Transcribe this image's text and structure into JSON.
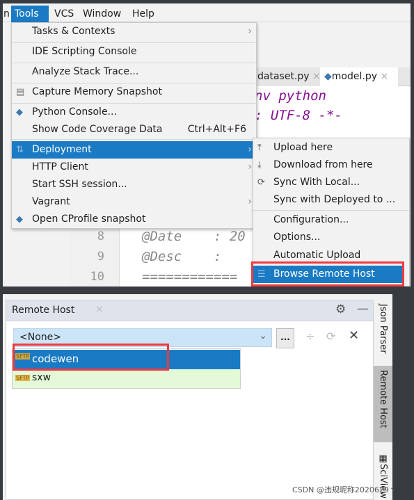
{
  "menubar": {
    "items": [
      {
        "label": "n"
      },
      {
        "label": "Tools"
      },
      {
        "label": "VCS"
      },
      {
        "label": "Window"
      },
      {
        "label": "Help"
      }
    ]
  },
  "editor": {
    "tabs": [
      {
        "label": "dataset.py"
      },
      {
        "label": "model.py"
      }
    ],
    "code": [
      "nv python",
      ": UTF-8 -*-",
      "@Date    : 20",
      "@Desc    :",
      "============"
    ],
    "line_numbers": [
      "8",
      "9",
      "10"
    ]
  },
  "tools_menu": {
    "items": [
      {
        "label": "Tasks & Contexts",
        "submenu": true
      },
      {
        "label": "IDE Scripting Console"
      },
      {
        "label": "Analyze Stack Trace..."
      },
      {
        "label": "Capture Memory Snapshot",
        "icon": "memory-snapshot-icon"
      },
      {
        "label": "Python Console...",
        "icon": "python-icon"
      },
      {
        "label": "Show Code Coverage Data",
        "shortcut": "Ctrl+Alt+F6"
      },
      {
        "label": "Deployment",
        "icon": "deployment-icon",
        "submenu": true,
        "selected": true
      },
      {
        "label": "HTTP Client",
        "submenu": true
      },
      {
        "label": "Start SSH session..."
      },
      {
        "label": "Vagrant",
        "submenu": true
      },
      {
        "label": "Open CProfile snapshot",
        "icon": "cprofile-icon"
      }
    ]
  },
  "deployment_menu": {
    "items": [
      {
        "label": "Upload here",
        "icon": "upload-icon"
      },
      {
        "label": "Download from here",
        "icon": "download-icon"
      },
      {
        "label": "Sync With Local...",
        "icon": "sync-icon"
      },
      {
        "label": "Sync with Deployed to ..."
      },
      {
        "label": "Configuration..."
      },
      {
        "label": "Options..."
      },
      {
        "label": "Automatic Upload"
      },
      {
        "label": "Browse Remote Host",
        "icon": "server-icon",
        "selected": true
      }
    ]
  },
  "remote_host": {
    "title": "Remote Host",
    "combo_value": "<None>",
    "more_label": "...",
    "options": [
      {
        "label": "codewen",
        "selected": true,
        "icon": "sftp-icon"
      },
      {
        "label": "sxw",
        "icon": "sftp-icon"
      }
    ],
    "side_tabs": [
      {
        "label": "Json Parser"
      },
      {
        "label": "Remote Host",
        "active": true
      },
      {
        "label": "SciView"
      }
    ]
  },
  "watermark": "CSDN @违规昵称2020629丶",
  "colors": {
    "selection": "#1a7bc4",
    "highlight_box": "#f03a3f",
    "combo_bg": "#cce4f7",
    "sxw_bg": "#e3f9d8",
    "code": "#871094"
  }
}
